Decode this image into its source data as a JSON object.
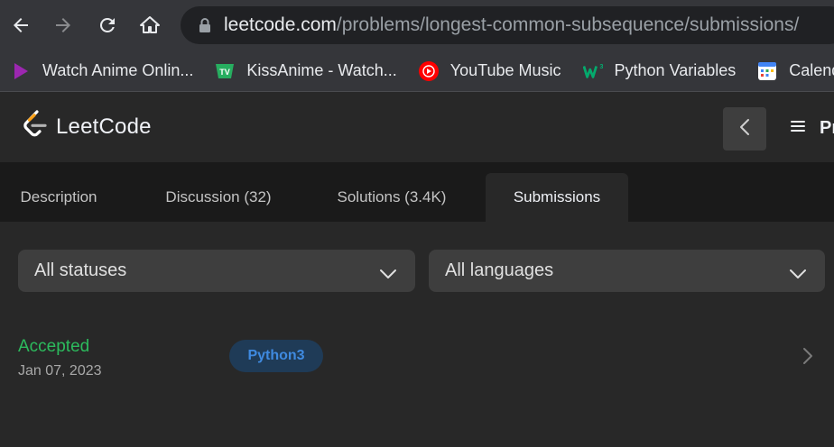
{
  "browser": {
    "url_host": "leetcode.com",
    "url_path": "/problems/longest-common-subsequence/submissions/",
    "bookmarks": [
      {
        "label": "Watch Anime Onlin...",
        "icon": "anime-play-icon",
        "color": "#9c27b0"
      },
      {
        "label": "KissAnime - Watch...",
        "icon": "kissanime-tv-icon",
        "color": "#27ae60"
      },
      {
        "label": "YouTube Music",
        "icon": "youtube-music-icon",
        "color": "#ff0000"
      },
      {
        "label": "Python Variables",
        "icon": "w3schools-icon",
        "color": "#04aa6d"
      },
      {
        "label": "Calend",
        "icon": "calendar-icon",
        "color": "#4285f4"
      }
    ]
  },
  "header": {
    "logo_text": "LeetCode",
    "menu_label": "Pr"
  },
  "tabs": [
    {
      "label": "Description",
      "active": false
    },
    {
      "label": "Discussion (32)",
      "active": false
    },
    {
      "label": "Solutions (3.4K)",
      "active": false
    },
    {
      "label": "Submissions",
      "active": true
    }
  ],
  "filters": {
    "status": "All statuses",
    "language": "All languages"
  },
  "submission": {
    "status": "Accepted",
    "date": "Jan 07, 2023",
    "language": "Python3"
  },
  "colors": {
    "accepted": "#2cbb5d",
    "badge_text": "#3f8ae0",
    "badge_bg": "#1f3b57"
  }
}
